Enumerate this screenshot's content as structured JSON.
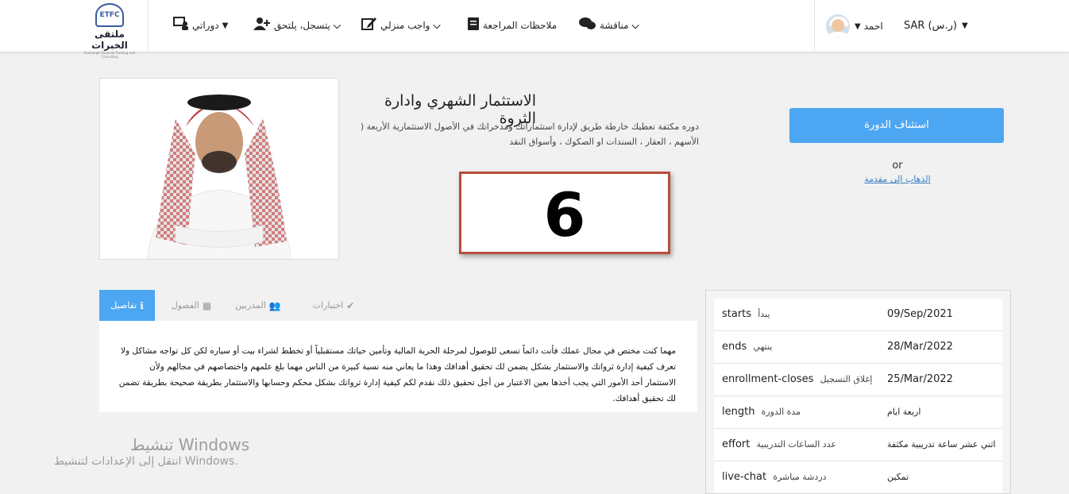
{
  "header": {
    "logo": {
      "emblem": "ETFC",
      "name": "ملتقى الخبرات",
      "tagline": "Exchange Financial Training and Consulting"
    },
    "nav": [
      {
        "label": "دوراتي",
        "icon": "courses-icon"
      },
      {
        "label": "يتسجل، يلتحق",
        "icon": "enroll-icon"
      },
      {
        "label": "واجب منزلي",
        "icon": "homework-icon"
      },
      {
        "label": "ملاحظات المراجعة",
        "icon": "notes-icon"
      },
      {
        "label": "مناقشة",
        "icon": "discussion-icon"
      }
    ],
    "user_name": "احمد",
    "currency": "SAR (ر.س)"
  },
  "course": {
    "title": "الاستثمار الشهري وادارة الثروة",
    "description": "دوره مكثفة تعطيك خارطة طريق لإدارة استثماراتك ومدخراتك في الأصول الاستثمارية الأربعة ( الأسهم ، العقار ، السندات او الصكوك ، وأسواق النقد",
    "number": "6",
    "resume_label": "استئناف الدورة",
    "or_text": "or",
    "intro_link": "الذهاب إلى مقدمة"
  },
  "tabs": [
    {
      "label": "تفاصيل",
      "icon": "info-icon"
    },
    {
      "label": "الفصول",
      "icon": "chapters-icon"
    },
    {
      "label": "المدربين",
      "icon": "instructors-icon"
    },
    {
      "label": "اختبارات",
      "icon": "check-icon"
    }
  ],
  "details_text": "مهما كنت مختص في مجال عملك فأنت دائماً تسعى للوصول لمرحلة الحرية المالية وتأمين حياتك مستقبلياً أو تخطط لشراء بيت أو سياره لكن كل تواجه مشاكل ولا تعرف كيفية إدارة ثرواتك والاستثمار بشكل يضمن لك تحقيق أهدافك وهذا ما يعاني منه نسبة كبيرة من الناس مهما بلغ علمهم واختصاصهم في مجالهم ولأن الاستثمار أحد الأمور التي يجب أخذها بعين الاعتبار من أجل تحقيق ذلك نقدم لكم كيفية إدارة ثرواتك بشكل محكم وحسابها والاستثمار بطريقة صحيحة بطريقة تضمن لك تحقيق أهدافك.",
  "info": [
    {
      "key": "starts",
      "ar": "يبدأ",
      "value": "09/Sep/2021"
    },
    {
      "key": "ends",
      "ar": "ينتهي",
      "value": "28/Mar/2022"
    },
    {
      "key": "enrollment-closes",
      "ar": "إغلاق التسجيل",
      "value": "25/Mar/2022"
    },
    {
      "key": "length",
      "ar": "مدة الدورة",
      "value": "اربعة ايام"
    },
    {
      "key": "effort",
      "ar": "عدد الساعات التدريبية",
      "value": "اثني عشر ساعة تدريبية مكثفة"
    },
    {
      "key": "live-chat",
      "ar": "دردشة مباشرة",
      "value": "تمكين"
    }
  ],
  "watermark": {
    "title": "تنشيط Windows",
    "subtitle": "انتقل إلى الإعدادات لتنشيط Windows."
  }
}
